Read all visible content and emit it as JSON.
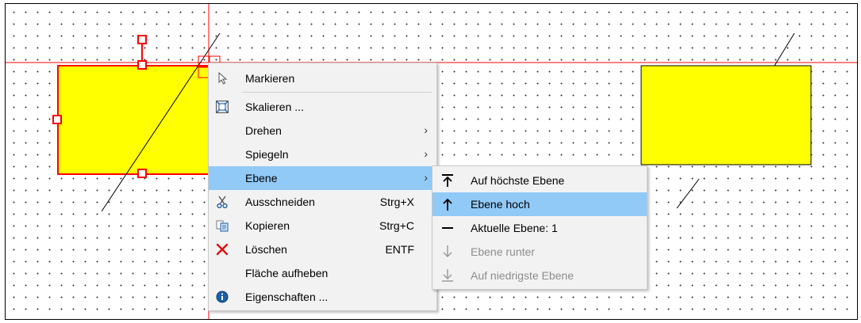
{
  "colors": {
    "shape_fill": "#ffff00",
    "selection_color": "#ff0000",
    "menu_background": "#f2f2f2",
    "menu_highlight": "#91c9f7"
  },
  "canvas": {
    "left_shape": {
      "name": "left-rectangle",
      "selected": true
    },
    "right_shape": {
      "name": "right-rectangle",
      "selected": false
    }
  },
  "context_menu": {
    "items": [
      {
        "label": "Markieren",
        "icon": "cursor-arrow-icon"
      },
      {
        "label": "Skalieren ...",
        "icon": "scale-icon"
      },
      {
        "label": "Drehen",
        "submenu": true
      },
      {
        "label": "Spiegeln",
        "submenu": true
      },
      {
        "label": "Ebene",
        "submenu": true,
        "highlighted": true
      },
      {
        "label": "Ausschneiden",
        "shortcut": "Strg+X",
        "icon": "scissors-icon"
      },
      {
        "label": "Kopieren",
        "shortcut": "Strg+C",
        "icon": "copy-icon"
      },
      {
        "label": "Löschen",
        "shortcut": "ENTF",
        "icon": "delete-x-icon"
      },
      {
        "label": "Fläche aufheben"
      },
      {
        "label": "Eigenschaften ...",
        "icon": "info-icon"
      }
    ]
  },
  "submenu": {
    "items": [
      {
        "label": "Auf höchste Ebene",
        "icon": "arrow-to-top-icon",
        "enabled": true
      },
      {
        "label": "Ebene hoch",
        "icon": "arrow-up-icon",
        "enabled": true,
        "highlighted": true
      },
      {
        "label": "Aktuelle Ebene: 1",
        "icon": "dash-icon",
        "enabled": true
      },
      {
        "label": "Ebene runter",
        "icon": "arrow-down-icon",
        "enabled": false
      },
      {
        "label": "Auf niedrigste Ebene",
        "icon": "arrow-to-bottom-icon",
        "enabled": false
      }
    ]
  }
}
